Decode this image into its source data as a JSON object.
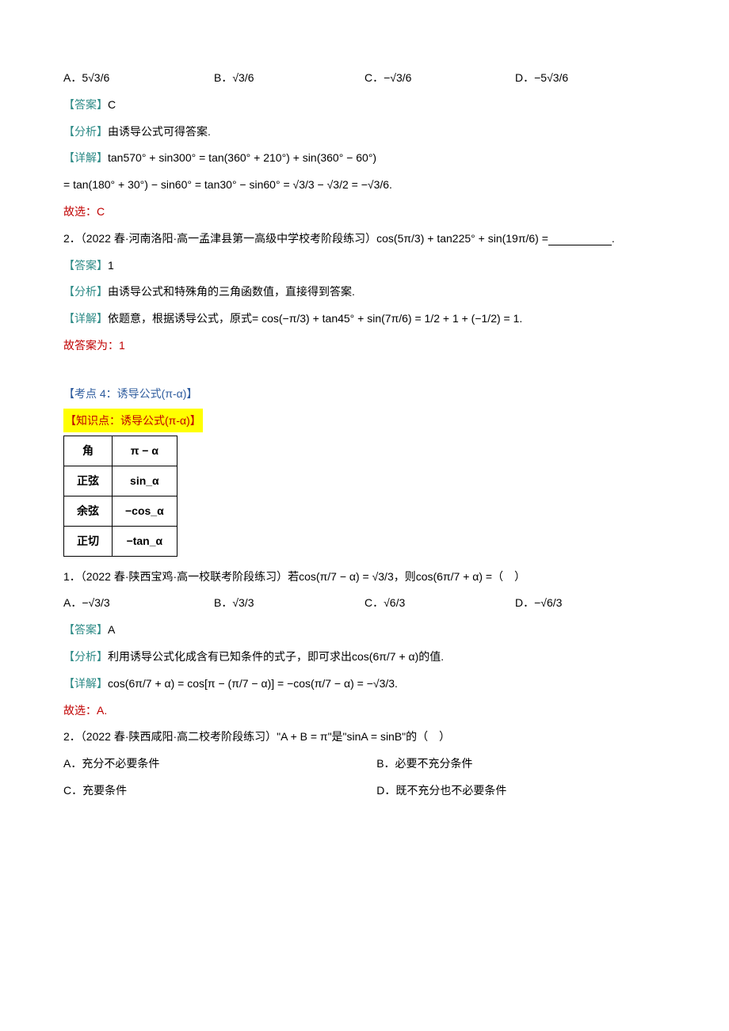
{
  "q0": {
    "A": "A．5√3/6",
    "B": "B．√3/6",
    "C": "C．−√3/6",
    "D": "D．−5√3/6",
    "ans_label": "【答案】",
    "ans": "C",
    "ana_label": "【分析】",
    "ana": "由诱导公式可得答案.",
    "det_label": "【详解】",
    "det1": "tan570° + sin300° = tan(360° + 210°) + sin(360° − 60°)",
    "det2": "= tan(180° + 30°) − sin60° = tan30° − sin60° = √3/3 − √3/2 = −√3/6.",
    "sel": "故选：C"
  },
  "q2": {
    "stem": "2．（2022 春·河南洛阳·高一孟津县第一高级中学校考阶段练习）cos(5π/3) + tan225° + sin(19π/6) =",
    "tail": ".",
    "ans_label": "【答案】",
    "ans": "1",
    "ana_label": "【分析】",
    "ana": "由诱导公式和特殊角的三角函数值，直接得到答案.",
    "det_label": "【详解】",
    "det": "依题意，根据诱导公式，原式= cos(−π/3) + tan45° + sin(7π/6) = 1/2 + 1 + (−1/2) = 1.",
    "sel": "故答案为：1"
  },
  "kp": {
    "title": "【考点 4：诱导公式(π-α)】",
    "know": "【知识点：诱导公式(π-α)】",
    "r1a": "角",
    "r1b": "π − α",
    "r2a": "正弦",
    "r2b": "sin_α",
    "r3a": "余弦",
    "r3b": "−cos_α",
    "r4a": "正切",
    "r4b": "−tan_α"
  },
  "q3": {
    "stem": "1．（2022 春·陕西宝鸡·高一校联考阶段练习）若cos(π/7 − α) = √3/3，则cos(6π/7 + α) =（　）",
    "A": "A．−√3/3",
    "B": "B．√3/3",
    "C": "C．√6/3",
    "D": "D．−√6/3",
    "ans_label": "【答案】",
    "ans": "A",
    "ana_label": "【分析】",
    "ana": "利用诱导公式化成含有已知条件的式子，即可求出cos(6π/7 + α)的值.",
    "det_label": "【详解】",
    "det": "cos(6π/7 + α) = cos[π − (π/7 − α)] = −cos(π/7 − α) = −√3/3.",
    "sel": "故选：A."
  },
  "q4": {
    "stem": "2．（2022 春·陕西咸阳·高二校考阶段练习）\"A + B = π\"是\"sinA = sinB\"的（　）",
    "A": "A．充分不必要条件",
    "B": "B．必要不充分条件",
    "C": "C．充要条件",
    "D": "D．既不充分也不必要条件"
  }
}
